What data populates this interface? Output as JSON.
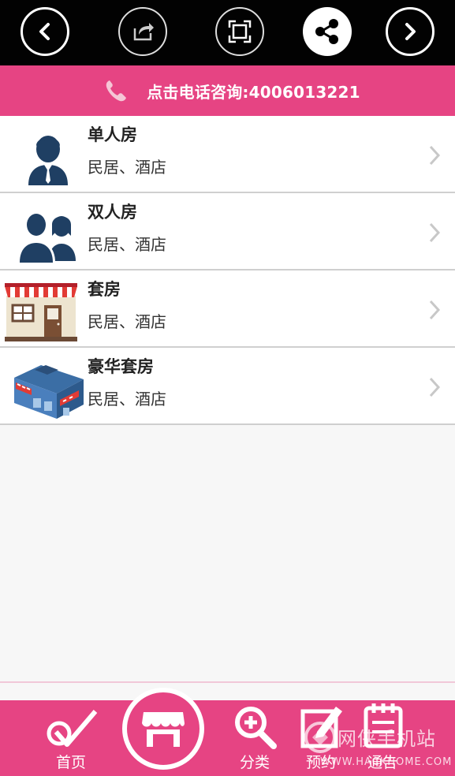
{
  "toolbar": {
    "buttons": [
      {
        "name": "back-button",
        "icon": "chevron-left-icon"
      },
      {
        "name": "share-out-button",
        "icon": "share-arrow-icon"
      },
      {
        "name": "fullscreen-button",
        "icon": "fullscreen-icon"
      },
      {
        "name": "share-button",
        "icon": "share-nodes-icon"
      },
      {
        "name": "forward-button",
        "icon": "chevron-right-icon"
      }
    ]
  },
  "phone_bar": {
    "icon": "phone-icon",
    "text": "点击电话咨询:4006013221"
  },
  "rooms": [
    {
      "title": "单人房",
      "subtitle": "民居、酒店",
      "icon": "single-person-icon"
    },
    {
      "title": "双人房",
      "subtitle": "民居、酒店",
      "icon": "two-people-icon"
    },
    {
      "title": "套房",
      "subtitle": "民居、酒店",
      "icon": "shop-front-icon"
    },
    {
      "title": "豪华套房",
      "subtitle": "民居、酒店",
      "icon": "building-icon"
    }
  ],
  "bottom_nav": {
    "items": [
      {
        "label": "首页",
        "icon": "home-check-icon"
      },
      {
        "label": "",
        "icon": "store-icon"
      },
      {
        "label": "分类",
        "icon": "zoom-plus-icon"
      },
      {
        "label": "预约",
        "icon": "edit-icon"
      },
      {
        "label": "通告",
        "icon": "notepad-icon"
      }
    ]
  },
  "watermark": {
    "title": "网侠手机站",
    "url": "WWW.HACKHOME.COM"
  },
  "colors": {
    "toolbar_bg": "#020202",
    "accent_pink": "#e64483",
    "list_bg": "#ffffff",
    "page_bg": "#f7f7f7",
    "icon_navy": "#1f3f63"
  }
}
